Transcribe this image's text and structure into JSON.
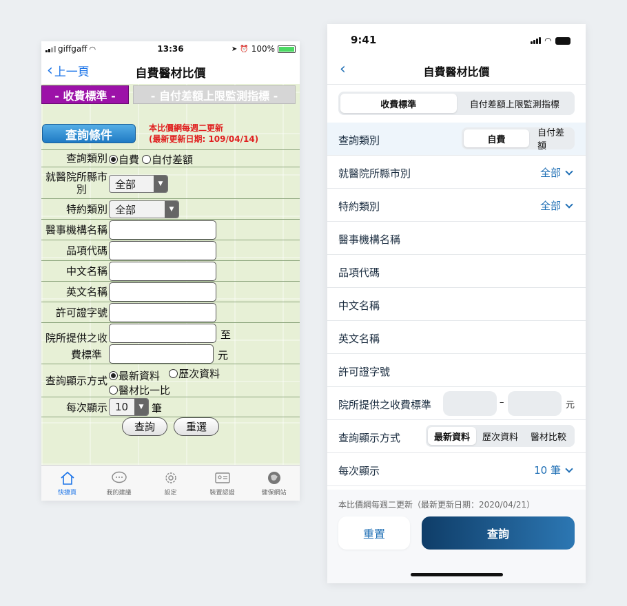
{
  "old_app": {
    "status": {
      "carrier": "giffgaff",
      "time": "13:36",
      "battery": "100%"
    },
    "nav": {
      "back_label": "上一頁",
      "title": "自費醫材比價"
    },
    "tabs": {
      "active": "- 收費標準 -",
      "inactive": "- 自付差額上限監測指標 -"
    },
    "query_button": "查詢條件",
    "notice": {
      "line1": "本比價網每週二更新",
      "line2": "(最新更新日期: 109/04/14)"
    },
    "labels": {
      "query_type": "查詢類別",
      "city_line1": "就醫院所縣市",
      "city_line2": "別",
      "contract": "特約類別",
      "institution": "醫事機構名稱",
      "item_code": "品項代碼",
      "chinese_name": "中文名稱",
      "english_name": "英文名稱",
      "license": "許可證字號",
      "fee_line1": "院所提供之收",
      "fee_line2": "費標準",
      "display_mode": "查詢顯示方式",
      "per_page": "每次顯示"
    },
    "query_type_options": [
      "自費",
      "自付差額"
    ],
    "city_value": "全部",
    "contract_value": "全部",
    "fee_to": "至",
    "fee_unit": "元",
    "display_options": [
      "最新資料",
      "歷次資料",
      "醫材比一比"
    ],
    "per_page_value": "10",
    "per_page_unit": "筆",
    "buttons": {
      "search": "查詢",
      "reset": "重選"
    },
    "tabbar": [
      "快捷頁",
      "我的建議",
      "設定",
      "裝置認證",
      "健保網站"
    ]
  },
  "new_app": {
    "status": {
      "time": "9:41"
    },
    "nav": {
      "title": "自費醫材比價"
    },
    "top_tabs": [
      "收費標準",
      "自付差額上限監測指標"
    ],
    "rows": {
      "query_type": "查詢類別",
      "query_type_options": [
        "自費",
        "自付差額"
      ],
      "city": "就醫院所縣市別",
      "city_value": "全部",
      "contract": "特約類別",
      "contract_value": "全部",
      "institution": "醫事機構名稱",
      "item_code": "品項代碼",
      "chinese_name": "中文名稱",
      "english_name": "英文名稱",
      "license": "許可證字號",
      "fee": "院所提供之收費標準",
      "fee_dash": "–",
      "fee_unit": "元",
      "display_mode": "查詢顯示方式",
      "display_options": [
        "最新資料",
        "歷次資料",
        "醫材比較"
      ],
      "per_page": "每次顯示",
      "per_page_value": "10 筆"
    },
    "footer": {
      "note": "本比價網每週二更新（最新更新日期：2020/04/21）",
      "reset": "重置",
      "search": "查詢"
    }
  },
  "colors": {
    "old_tab_active": "#9c12a8",
    "new_primary": "#1f6fb5",
    "new_button_dark": "#0f3d68"
  }
}
